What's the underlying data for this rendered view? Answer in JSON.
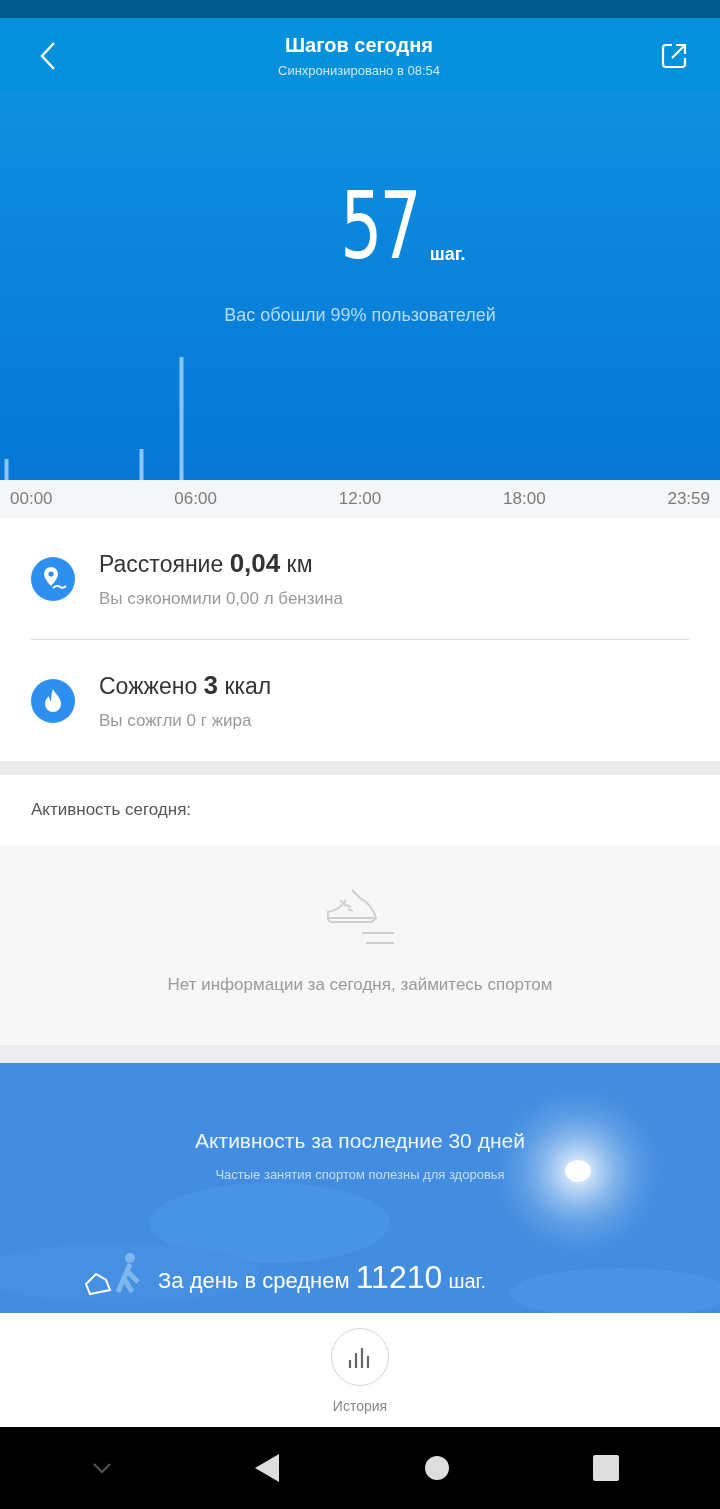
{
  "header": {
    "title": "Шагов сегодня",
    "subtitle": "Синхронизировано в 08:54"
  },
  "hero": {
    "steps": "57",
    "unit": "шаг.",
    "note": "Вас обошли 99% пользователей"
  },
  "time_labels": [
    "00:00",
    "06:00",
    "12:00",
    "18:00",
    "23:59"
  ],
  "stats": [
    {
      "kind": "distance",
      "label": "Расстояние",
      "value": "0,04",
      "unit": "км",
      "note": "Вы сэкономили 0,00 л бензина"
    },
    {
      "kind": "calories",
      "label": "Сожжено",
      "value": "3",
      "unit": "ккал",
      "note": "Вы сожгли 0 г жира"
    }
  ],
  "activity": {
    "title": "Активность сегодня:",
    "empty": "Нет информации за сегодня, займитесь спортом"
  },
  "monthly": {
    "title": "Активность за последние 30 дней",
    "subtitle": "Частые занятия спортом полезны для здоровья",
    "label": "За день в среднем",
    "value": "11210",
    "unit": "шаг."
  },
  "bottom_tab": {
    "label": "История"
  }
}
